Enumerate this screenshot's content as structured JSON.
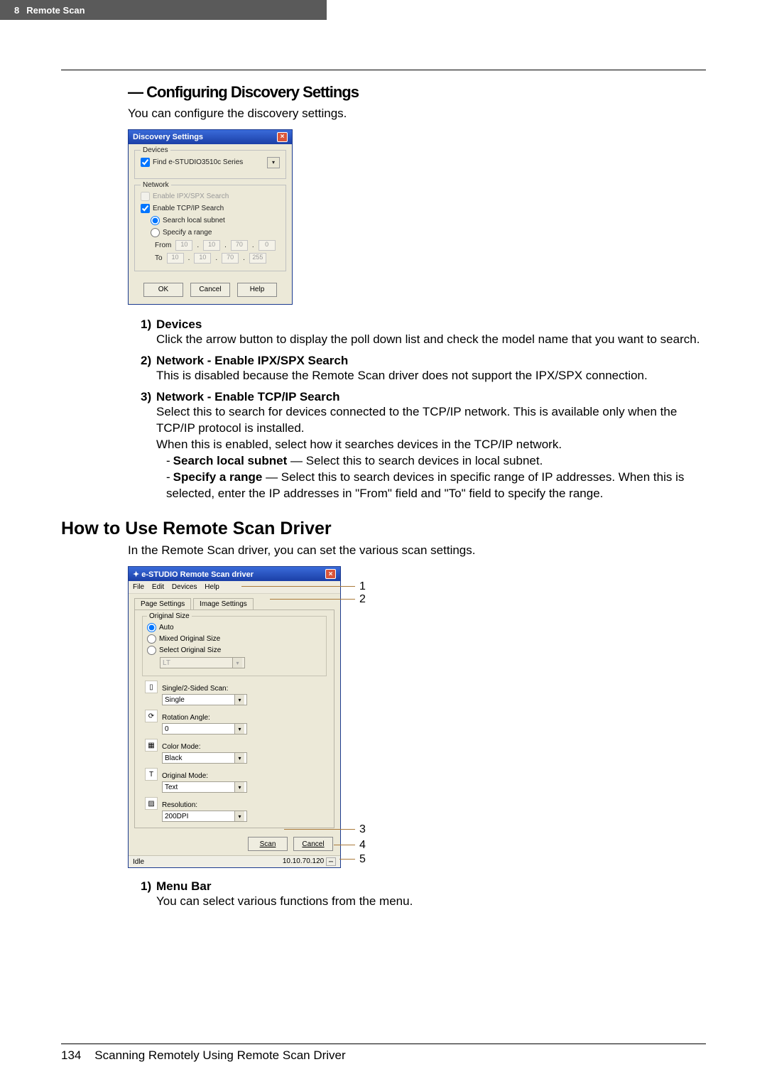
{
  "header": {
    "chapter_num": "8",
    "chapter_title": "Remote Scan"
  },
  "section": {
    "configuring_title": "— Configuring Discovery Settings",
    "configuring_intro": "You can configure the discovery settings."
  },
  "dlg1": {
    "title": "Discovery Settings",
    "devices_label": "Devices",
    "find_label": "Find e-STUDIO3510c Series",
    "network_label": "Network",
    "ipx_label": "Enable IPX/SPX Search",
    "tcp_label": "Enable TCP/IP Search",
    "local_label": "Search local subnet",
    "range_label": "Specify a range",
    "from_label": "From",
    "to_label": "To",
    "from_vals": [
      "10",
      "10",
      "70",
      "0"
    ],
    "to_vals": [
      "10",
      "10",
      "70",
      "255"
    ],
    "ok": "OK",
    "cancel": "Cancel",
    "help": "Help"
  },
  "list": {
    "i1_head": "Devices",
    "i1_body": "Click the arrow button to display the poll down list and check the model name that you want to search.",
    "i2_head": "Network - Enable IPX/SPX Search",
    "i2_body": "This is disabled because the Remote Scan driver does not support the IPX/SPX connection.",
    "i3_head": "Network - Enable TCP/IP Search",
    "i3_body1": "Select this to search for devices connected to the TCP/IP network.  This is available only when the TCP/IP protocol is installed.",
    "i3_body2": "When this is enabled, select how it searches devices in the TCP/IP network.",
    "i3_sub1_b": "Search local subnet",
    "i3_sub1_t": " — Select this to search devices in local subnet.",
    "i3_sub2_b": "Specify a range",
    "i3_sub2_t": " — Select this to search devices in specific range of IP addresses. When this is selected, enter the IP addresses in \"From\" field and \"To\" field to specify the range."
  },
  "howto": {
    "heading": "How to Use Remote Scan Driver",
    "intro": "In the Remote Scan driver, you can set the various scan settings."
  },
  "dlg2": {
    "title": "e-STUDIO Remote Scan driver",
    "menu": {
      "file": "File",
      "edit": "Edit",
      "devices": "Devices",
      "help": "Help"
    },
    "tab1": "Page Settings",
    "tab2": "Image Settings",
    "orig_label": "Original Size",
    "auto": "Auto",
    "mixed": "Mixed Original Size",
    "select": "Select Original Size",
    "select_val": "LT",
    "single_label": "Single/2-Sided Scan:",
    "single_val": "Single",
    "rot_label": "Rotation Angle:",
    "rot_val": "0",
    "color_label": "Color Mode:",
    "color_val": "Black",
    "origmode_label": "Original Mode:",
    "origmode_val": "Text",
    "res_label": "Resolution:",
    "res_val": "200DPI",
    "scan_btn": "Scan",
    "cancel_btn": "Cancel",
    "status_idle": "Idle",
    "status_ip": "10.10.70.120"
  },
  "callouts": {
    "n1": "1",
    "n2": "2",
    "n3": "3",
    "n4": "4",
    "n5": "5"
  },
  "list2": {
    "i1_head": "Menu Bar",
    "i1_body": "You can select various functions from the menu."
  },
  "footer": {
    "page": "134",
    "title": "Scanning Remotely Using Remote Scan Driver"
  }
}
